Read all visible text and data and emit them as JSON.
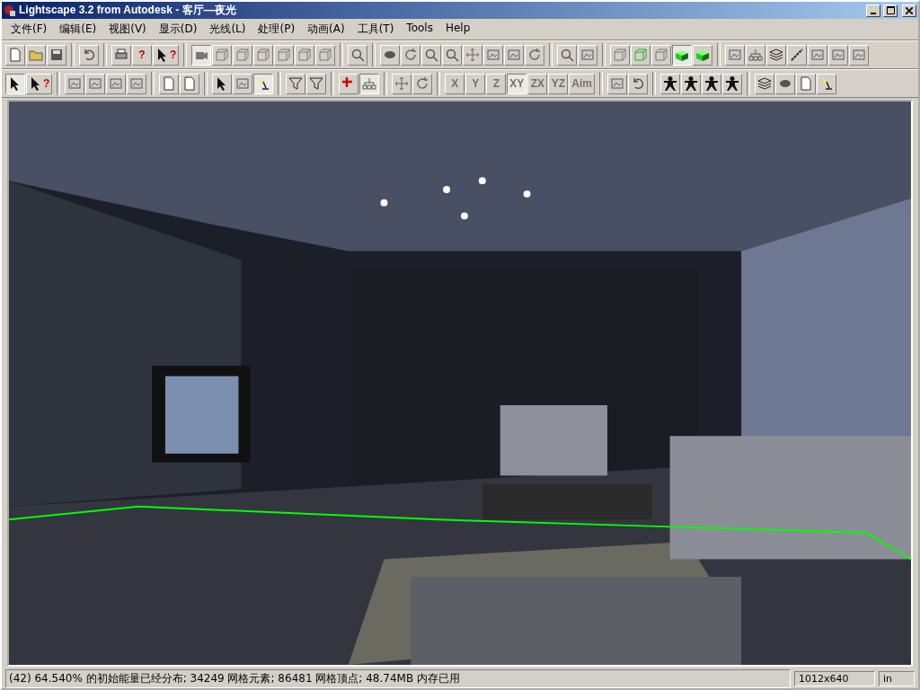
{
  "window": {
    "title": "Lightscape 3.2 from Autodesk - 客厅—夜光"
  },
  "menu": [
    "文件(F)",
    "编辑(E)",
    "视图(V)",
    "显示(D)",
    "光线(L)",
    "处理(P)",
    "动画(A)",
    "工具(T)",
    "Tools",
    "Help"
  ],
  "toolbar_1": [
    [
      {
        "kind": "page",
        "pressed": false
      },
      {
        "kind": "folder",
        "pressed": false
      },
      {
        "kind": "disk",
        "pressed": false
      }
    ],
    [
      {
        "kind": "undo",
        "pressed": false
      }
    ],
    [
      {
        "kind": "printer",
        "pressed": false
      },
      {
        "kind": "text",
        "label": "?",
        "pressed": false
      },
      {
        "kind": "cursor-text",
        "label": "?",
        "pressed": false
      }
    ],
    [
      {
        "kind": "camera",
        "pressed": true
      },
      {
        "kind": "cube",
        "pressed": false
      },
      {
        "kind": "cube",
        "pressed": false
      },
      {
        "kind": "cube",
        "pressed": false
      },
      {
        "kind": "cube",
        "pressed": false
      },
      {
        "kind": "cube",
        "pressed": false
      },
      {
        "kind": "cube",
        "pressed": false
      }
    ],
    [
      {
        "kind": "magnifier",
        "pressed": false
      }
    ],
    [
      {
        "kind": "eye",
        "pressed": false
      },
      {
        "kind": "rotate",
        "pressed": false
      },
      {
        "kind": "magnifier",
        "pressed": false
      },
      {
        "kind": "magnifier",
        "pressed": false
      },
      {
        "kind": "move",
        "pressed": false
      },
      {
        "kind": "frame",
        "pressed": false
      },
      {
        "kind": "frame",
        "pressed": false
      },
      {
        "kind": "rotate",
        "pressed": false
      }
    ],
    [
      {
        "kind": "magnifier",
        "pressed": false
      },
      {
        "kind": "frame",
        "pressed": false
      }
    ],
    [
      {
        "kind": "cube",
        "pressed": false
      },
      {
        "kind": "green-cube",
        "pressed": false
      },
      {
        "kind": "cube",
        "pressed": false
      },
      {
        "kind": "solid-cube",
        "pressed": true
      },
      {
        "kind": "solid-cube",
        "pressed": false
      }
    ],
    [
      {
        "kind": "frame",
        "pressed": false
      },
      {
        "kind": "split",
        "pressed": false
      },
      {
        "kind": "layers",
        "pressed": false
      },
      {
        "kind": "line",
        "pressed": false
      },
      {
        "kind": "frame",
        "pressed": false
      },
      {
        "kind": "frame",
        "pressed": false
      },
      {
        "kind": "frame",
        "pressed": false
      }
    ]
  ],
  "toolbar_2": [
    [
      {
        "kind": "cursor",
        "pressed": true
      },
      {
        "kind": "cursor-text",
        "label": "?",
        "pressed": false
      }
    ],
    [
      {
        "kind": "frame",
        "pressed": false
      },
      {
        "kind": "frame",
        "pressed": false
      },
      {
        "kind": "frame",
        "pressed": false
      },
      {
        "kind": "frame",
        "pressed": false
      }
    ],
    [
      {
        "kind": "page",
        "pressed": false
      },
      {
        "kind": "page",
        "pressed": false
      }
    ],
    [
      {
        "kind": "cursor",
        "pressed": false
      },
      {
        "kind": "frame",
        "pressed": false
      },
      {
        "kind": "lamp",
        "pressed": true
      }
    ],
    [
      {
        "kind": "funnel",
        "pressed": false
      },
      {
        "kind": "funnel",
        "pressed": false
      }
    ],
    [
      {
        "kind": "plus",
        "pressed": false
      },
      {
        "kind": "split",
        "pressed": true
      }
    ],
    [
      {
        "kind": "move",
        "pressed": false
      },
      {
        "kind": "rotate",
        "pressed": false
      }
    ],
    [
      {
        "kind": "text",
        "label": "X",
        "pressed": false
      },
      {
        "kind": "text",
        "label": "Y",
        "pressed": false
      },
      {
        "kind": "text",
        "label": "Z",
        "pressed": false
      },
      {
        "kind": "text",
        "label": "XY",
        "pressed": true
      },
      {
        "kind": "text",
        "label": "ZX",
        "pressed": false
      },
      {
        "kind": "text",
        "label": "YZ",
        "pressed": false
      },
      {
        "kind": "text",
        "label": "Aim",
        "pressed": false
      }
    ],
    [
      {
        "kind": "frame",
        "pressed": false
      },
      {
        "kind": "undo",
        "pressed": false
      }
    ],
    [
      {
        "kind": "person",
        "pressed": false
      },
      {
        "kind": "person",
        "pressed": false
      },
      {
        "kind": "person",
        "pressed": false
      },
      {
        "kind": "person",
        "pressed": false
      }
    ],
    [
      {
        "kind": "layers",
        "pressed": false
      },
      {
        "kind": "eye",
        "pressed": false
      },
      {
        "kind": "page",
        "pressed": false
      },
      {
        "kind": "lamp",
        "pressed": false
      }
    ]
  ],
  "viewport": {
    "kind": "picture"
  },
  "status_bar": {
    "message": "(42) 64.540% 的初始能量已经分布; 34249 网格元素; 86481 网格顶点; 48.74MB 内存已用",
    "resolution": "1012x640",
    "units": "in"
  }
}
